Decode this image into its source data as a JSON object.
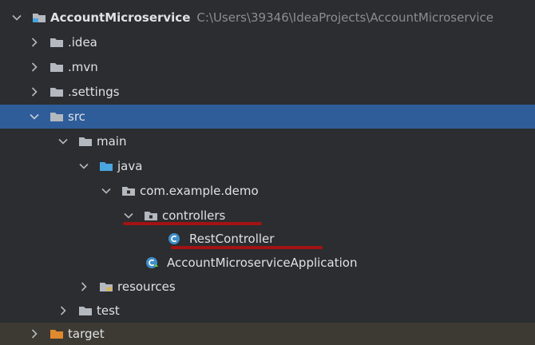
{
  "project": {
    "name": "AccountMicroservice",
    "path": "C:\\Users\\39346\\IdeaProjects\\AccountMicroservice"
  },
  "items": {
    "idea": ".idea",
    "mvn": ".mvn",
    "settings": ".settings",
    "src": "src",
    "main": "main",
    "java": "java",
    "package": "com.example.demo",
    "controllers": "controllers",
    "rest_controller": "RestController",
    "application": "AccountMicroserviceApplication",
    "resources": "resources",
    "test": "test",
    "target": "target"
  },
  "colors": {
    "selected_row": "#2e5d9a",
    "annotation_underline": "#a31313",
    "folder": "#b4b8bf",
    "source_folder": "#4aa5e0",
    "excluded_folder": "#e08a2e",
    "class_icon": "#3f8ec9"
  }
}
